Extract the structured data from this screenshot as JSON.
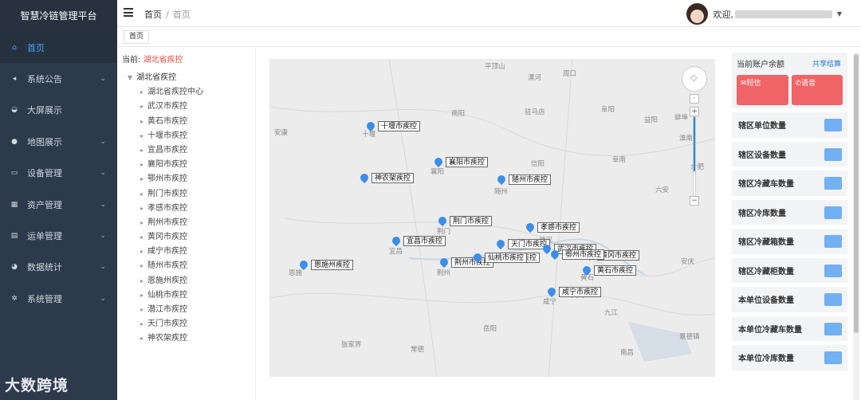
{
  "app": {
    "title": "智慧冷链管理平台"
  },
  "sidebar": {
    "items": [
      {
        "label": "首页",
        "icon": "home-icon",
        "glyph": "⌂",
        "active": true,
        "has_children": false
      },
      {
        "label": "系统公告",
        "icon": "megaphone-icon",
        "glyph": "◂",
        "has_children": true
      },
      {
        "label": "大屏展示",
        "icon": "gauge-icon",
        "glyph": "◒",
        "has_children": false
      },
      {
        "label": "地图展示",
        "icon": "map-marker-icon",
        "glyph": "●",
        "has_children": true
      },
      {
        "label": "设备管理",
        "icon": "monitor-icon",
        "glyph": "▭",
        "has_children": true
      },
      {
        "label": "资产管理",
        "icon": "grid-icon",
        "glyph": "▦",
        "has_children": true
      },
      {
        "label": "运单管理",
        "icon": "document-icon",
        "glyph": "▤",
        "has_children": true
      },
      {
        "label": "数据统计",
        "icon": "pie-chart-icon",
        "glyph": "◕",
        "has_children": true
      },
      {
        "label": "系统管理",
        "icon": "gear-icon",
        "glyph": "✲",
        "has_children": true
      }
    ]
  },
  "header": {
    "breadcrumb": [
      "首页",
      "首页"
    ],
    "welcome": "欢迎,",
    "menu_icon": "hamburger-icon"
  },
  "tabs": [
    {
      "label": "首页"
    }
  ],
  "tree": {
    "current_prefix": "当前:",
    "current_value": "湖北省疾控",
    "root": "湖北省疾控",
    "children": [
      "湖北省疾控中心",
      "武汉市疾控",
      "黄石市疾控",
      "十堰市疾控",
      "宜昌市疾控",
      "襄阳市疾控",
      "鄂州市疾控",
      "荆门市疾控",
      "孝感市疾控",
      "荆州市疾控",
      "黄冈市疾控",
      "咸宁市疾控",
      "随州市疾控",
      "恩施州疾控",
      "仙桃市疾控",
      "潜江市疾控",
      "天门市疾控",
      "神农架疾控"
    ]
  },
  "map": {
    "markers": [
      "十堰市疾控",
      "襄阳市疾控",
      "神农架疾控",
      "随州市疾控",
      "荆门市疾控",
      "孝感市疾控",
      "宜昌市疾控",
      "天门市疾控",
      "武汉市疾控",
      "黄冈市疾控",
      "荆州市疾控",
      "潜江市疾控",
      "鄂州市疾控",
      "黄石市疾控",
      "恩施州疾控",
      "咸宁市疾控",
      "仙桃市疾控"
    ],
    "cities": [
      "平顶山",
      "漯河",
      "周口",
      "南阳",
      "驻马店",
      "安康",
      "十堰",
      "襄阳",
      "信阳",
      "随州",
      "阜阳",
      "淮南",
      "蚌埠",
      "六安",
      "合肥",
      "荆门",
      "孝感",
      "武汉",
      "宜昌",
      "荆州",
      "咸宁",
      "黄冈",
      "安庆",
      "恩施",
      "九江",
      "岳阳",
      "张家界",
      "常德",
      "南昌",
      "景德镇",
      "益阳",
      "阜南",
      "黄石"
    ],
    "zoom_plus": "+",
    "zoom_minus": "−"
  },
  "account": {
    "title": "当前账户余额",
    "link": "共享结算",
    "sms": "短信",
    "voice": "语音"
  },
  "stats": [
    "辖区单位数量",
    "辖区设备数量",
    "辖区冷藏车数量",
    "辖区冷库数量",
    "辖区冷藏箱数量",
    "辖区冷藏柜数量",
    "本单位设备数量",
    "本单位冷藏车数量",
    "本单位冷库数量"
  ],
  "watermark": "大数跨境",
  "colors": {
    "sidebar": "#2d3a4b",
    "accent": "#4aa3ff",
    "danger": "#f06366",
    "pin": "#3b8eea",
    "highlight": "#e64b3c"
  }
}
